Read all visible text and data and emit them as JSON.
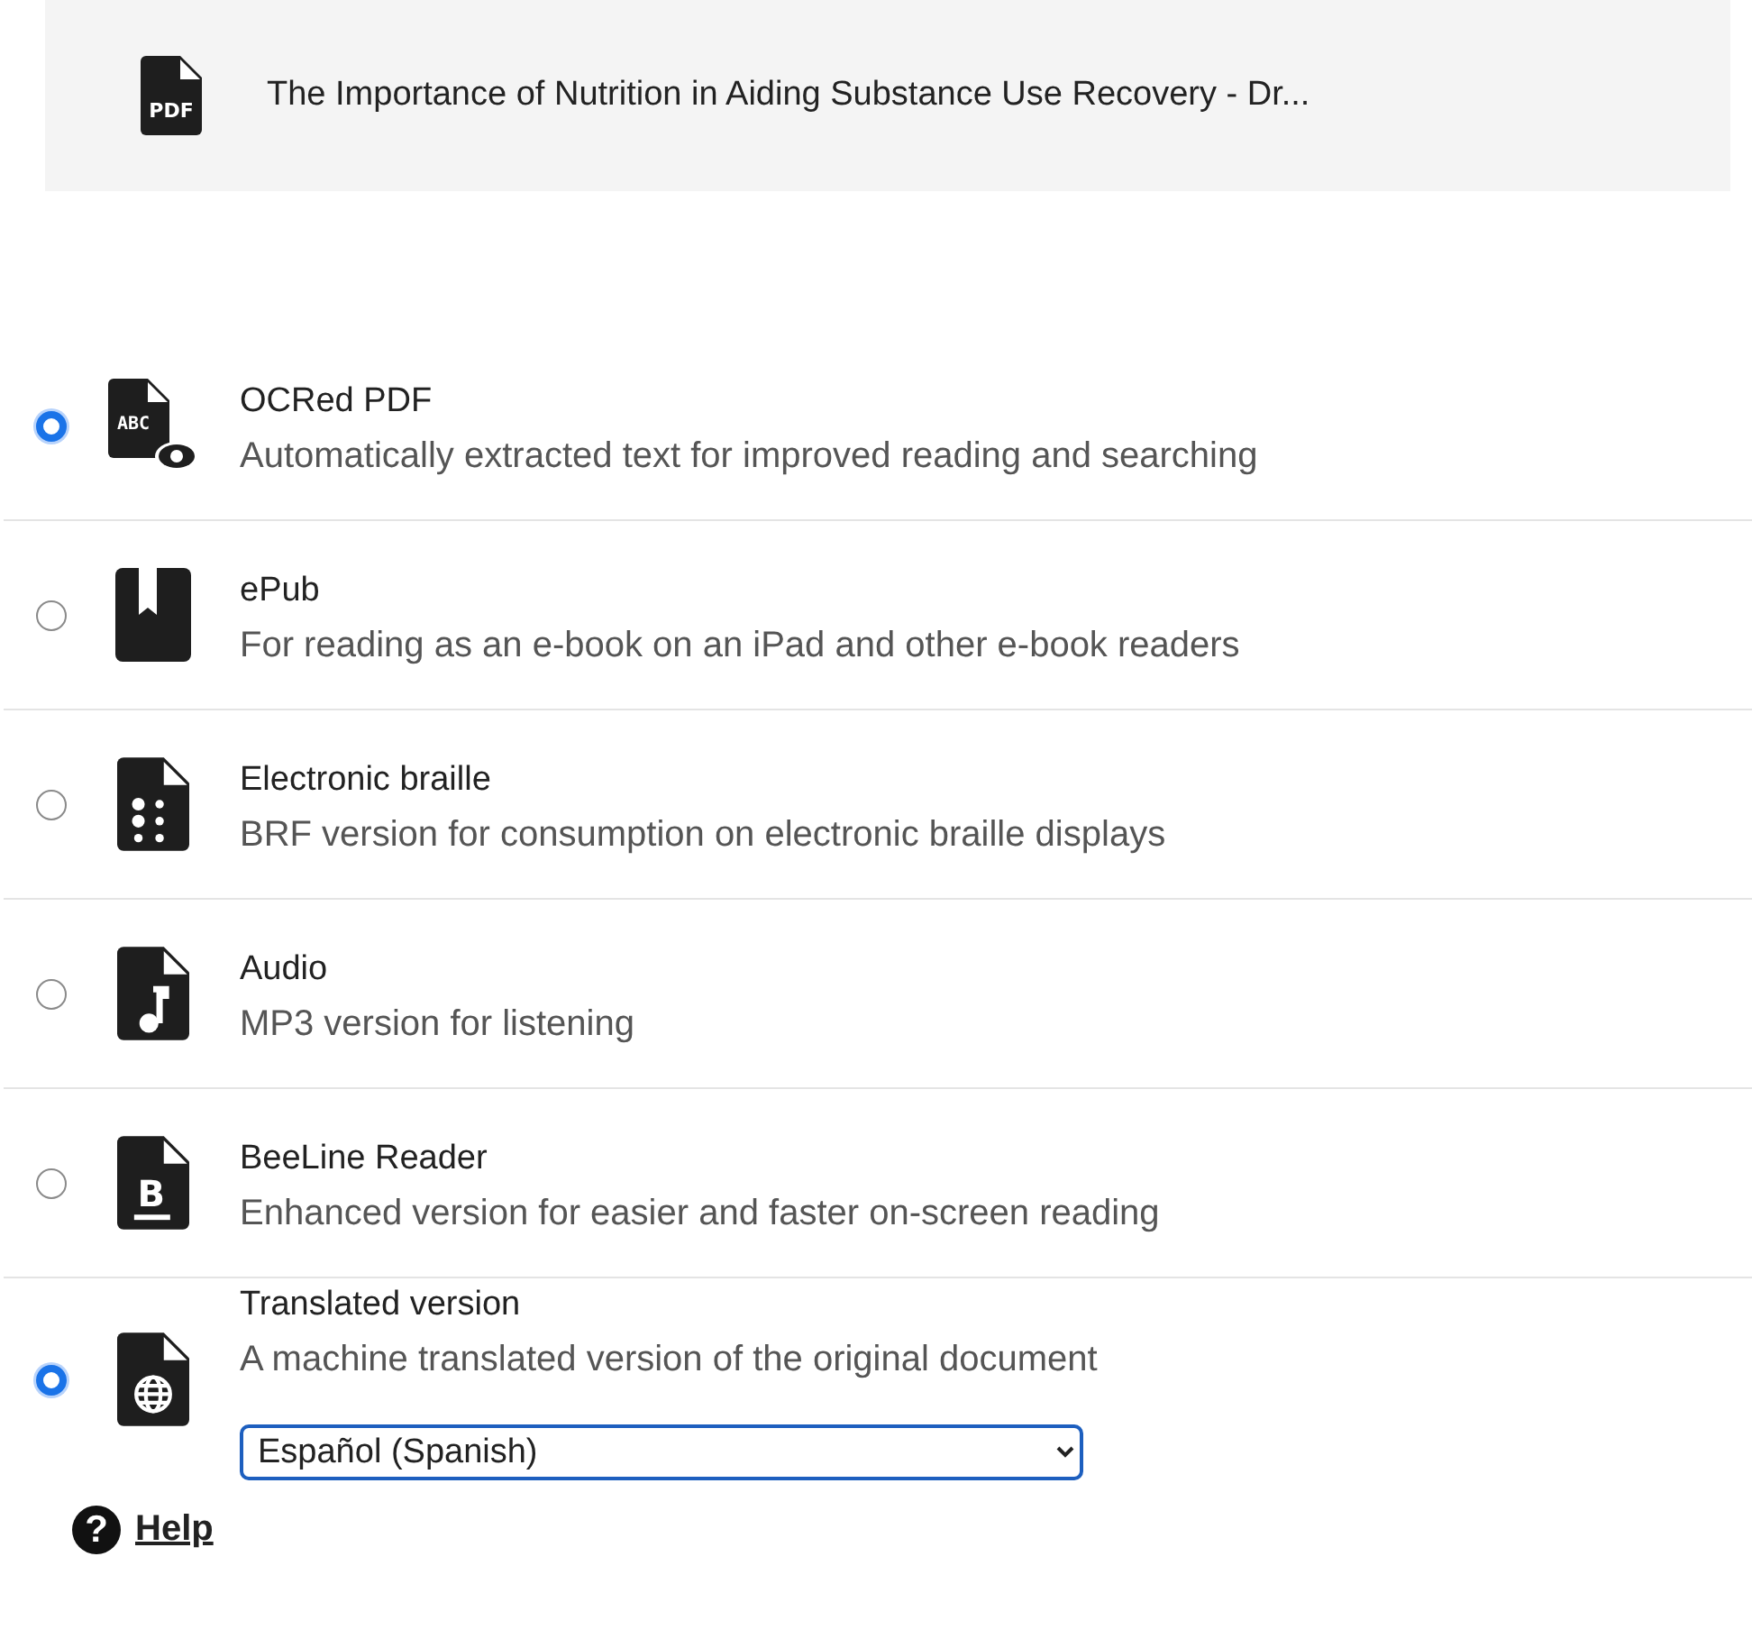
{
  "document": {
    "icon_text": "PDF",
    "title": "The Importance of Nutrition in Aiding Substance Use Recovery - Dr..."
  },
  "options": [
    {
      "kind": "ocr",
      "icon_text": "ABC",
      "title": "OCRed PDF",
      "description": "Automatically extracted text for improved reading and searching",
      "selected": true
    },
    {
      "kind": "epub",
      "title": "ePub",
      "description": "For reading as an e-book on an iPad and other e-book readers",
      "selected": false
    },
    {
      "kind": "braille",
      "title": "Electronic braille",
      "description": "BRF version for consumption on electronic braille displays",
      "selected": false
    },
    {
      "kind": "audio",
      "title": "Audio",
      "description": "MP3 version for listening",
      "selected": false
    },
    {
      "kind": "beeline",
      "icon_text": "B",
      "title": "BeeLine Reader",
      "description": "Enhanced version for easier and faster on-screen reading",
      "selected": false
    },
    {
      "kind": "translated",
      "title": "Translated version",
      "description": "A machine translated version of the original document",
      "selected": true,
      "language": "Español (Spanish)"
    }
  ],
  "help": {
    "icon_text": "?",
    "label": "Help"
  }
}
